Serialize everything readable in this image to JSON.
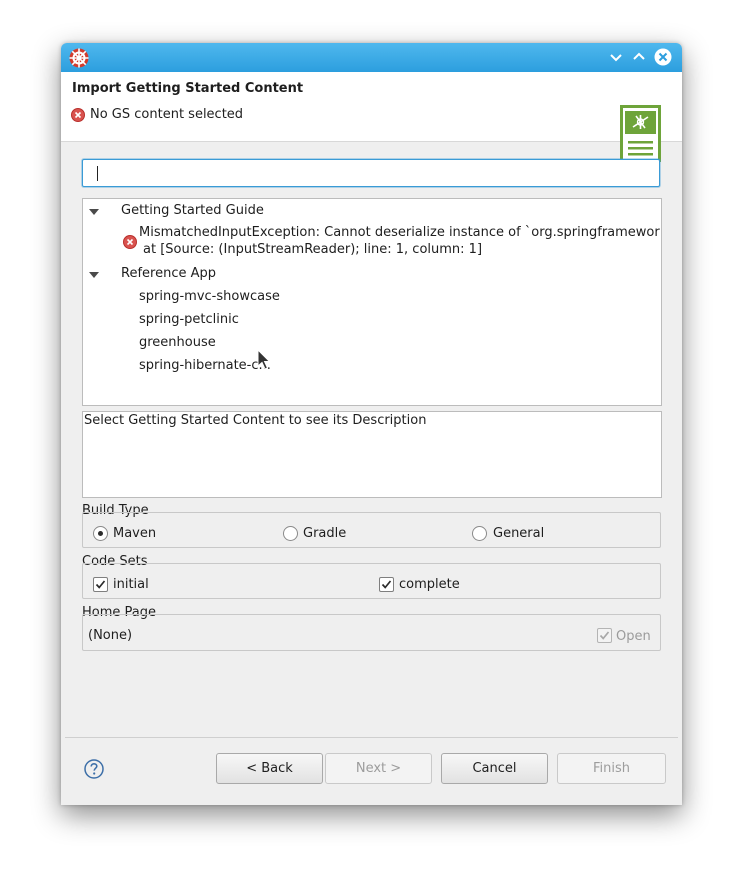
{
  "window": {
    "title": "Import Getting Started Content",
    "message": "No GS content selected",
    "icons": {
      "app": "app-logo-icon",
      "minimize": "chevron-down-icon",
      "maximize": "chevron-up-icon",
      "close": "close-icon",
      "error": "error-icon",
      "banner": "wizard-banner-icon"
    }
  },
  "search": {
    "value": ""
  },
  "tree": {
    "groups": [
      {
        "label": "Getting Started Guide",
        "items": [
          {
            "icon": "error-icon",
            "line1": "MismatchedInputException: Cannot deserialize instance of `org.springframewor",
            "line2": "at [Source: (InputStreamReader); line: 1, column: 1]"
          }
        ]
      },
      {
        "label": "Reference App",
        "items": [
          {
            "label": "spring-mvc-showcase"
          },
          {
            "label": "spring-petclinic"
          },
          {
            "label": "greenhouse"
          },
          {
            "label": "spring-hibernate-c..."
          }
        ]
      }
    ]
  },
  "description": {
    "text": "Select Getting Started Content to see its Description"
  },
  "build_type": {
    "label": "Build Type",
    "options": [
      {
        "label": "Maven",
        "selected": true
      },
      {
        "label": "Gradle",
        "selected": false
      },
      {
        "label": "General",
        "selected": false
      }
    ]
  },
  "code_sets": {
    "label": "Code Sets",
    "options": [
      {
        "label": "initial",
        "checked": true
      },
      {
        "label": "complete",
        "checked": true
      }
    ]
  },
  "home_page": {
    "label": "Home Page",
    "value": "(None)",
    "open_label": "Open",
    "open_checked": true,
    "open_enabled": false
  },
  "buttons": {
    "back": "< Back",
    "next": "Next >",
    "cancel": "Cancel",
    "finish": "Finish"
  },
  "colors": {
    "titlebar": "#2c9ede",
    "error": "#d9534f",
    "banner": "#6ea43a",
    "focus": "#3a9bd6"
  }
}
